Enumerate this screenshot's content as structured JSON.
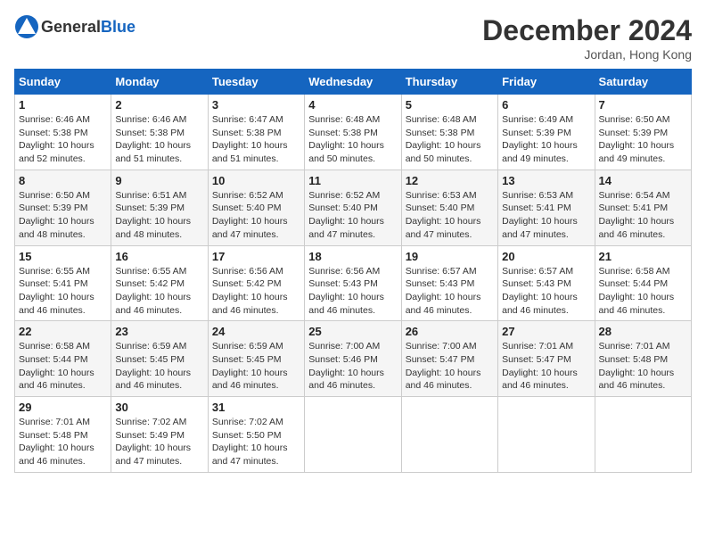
{
  "header": {
    "logo_general": "General",
    "logo_blue": "Blue",
    "month_title": "December 2024",
    "location": "Jordan, Hong Kong"
  },
  "columns": [
    "Sunday",
    "Monday",
    "Tuesday",
    "Wednesday",
    "Thursday",
    "Friday",
    "Saturday"
  ],
  "weeks": [
    [
      {
        "day": "1",
        "sunrise": "Sunrise: 6:46 AM",
        "sunset": "Sunset: 5:38 PM",
        "daylight": "Daylight: 10 hours and 52 minutes."
      },
      {
        "day": "2",
        "sunrise": "Sunrise: 6:46 AM",
        "sunset": "Sunset: 5:38 PM",
        "daylight": "Daylight: 10 hours and 51 minutes."
      },
      {
        "day": "3",
        "sunrise": "Sunrise: 6:47 AM",
        "sunset": "Sunset: 5:38 PM",
        "daylight": "Daylight: 10 hours and 51 minutes."
      },
      {
        "day": "4",
        "sunrise": "Sunrise: 6:48 AM",
        "sunset": "Sunset: 5:38 PM",
        "daylight": "Daylight: 10 hours and 50 minutes."
      },
      {
        "day": "5",
        "sunrise": "Sunrise: 6:48 AM",
        "sunset": "Sunset: 5:38 PM",
        "daylight": "Daylight: 10 hours and 50 minutes."
      },
      {
        "day": "6",
        "sunrise": "Sunrise: 6:49 AM",
        "sunset": "Sunset: 5:39 PM",
        "daylight": "Daylight: 10 hours and 49 minutes."
      },
      {
        "day": "7",
        "sunrise": "Sunrise: 6:50 AM",
        "sunset": "Sunset: 5:39 PM",
        "daylight": "Daylight: 10 hours and 49 minutes."
      }
    ],
    [
      {
        "day": "8",
        "sunrise": "Sunrise: 6:50 AM",
        "sunset": "Sunset: 5:39 PM",
        "daylight": "Daylight: 10 hours and 48 minutes."
      },
      {
        "day": "9",
        "sunrise": "Sunrise: 6:51 AM",
        "sunset": "Sunset: 5:39 PM",
        "daylight": "Daylight: 10 hours and 48 minutes."
      },
      {
        "day": "10",
        "sunrise": "Sunrise: 6:52 AM",
        "sunset": "Sunset: 5:40 PM",
        "daylight": "Daylight: 10 hours and 47 minutes."
      },
      {
        "day": "11",
        "sunrise": "Sunrise: 6:52 AM",
        "sunset": "Sunset: 5:40 PM",
        "daylight": "Daylight: 10 hours and 47 minutes."
      },
      {
        "day": "12",
        "sunrise": "Sunrise: 6:53 AM",
        "sunset": "Sunset: 5:40 PM",
        "daylight": "Daylight: 10 hours and 47 minutes."
      },
      {
        "day": "13",
        "sunrise": "Sunrise: 6:53 AM",
        "sunset": "Sunset: 5:41 PM",
        "daylight": "Daylight: 10 hours and 47 minutes."
      },
      {
        "day": "14",
        "sunrise": "Sunrise: 6:54 AM",
        "sunset": "Sunset: 5:41 PM",
        "daylight": "Daylight: 10 hours and 46 minutes."
      }
    ],
    [
      {
        "day": "15",
        "sunrise": "Sunrise: 6:55 AM",
        "sunset": "Sunset: 5:41 PM",
        "daylight": "Daylight: 10 hours and 46 minutes."
      },
      {
        "day": "16",
        "sunrise": "Sunrise: 6:55 AM",
        "sunset": "Sunset: 5:42 PM",
        "daylight": "Daylight: 10 hours and 46 minutes."
      },
      {
        "day": "17",
        "sunrise": "Sunrise: 6:56 AM",
        "sunset": "Sunset: 5:42 PM",
        "daylight": "Daylight: 10 hours and 46 minutes."
      },
      {
        "day": "18",
        "sunrise": "Sunrise: 6:56 AM",
        "sunset": "Sunset: 5:43 PM",
        "daylight": "Daylight: 10 hours and 46 minutes."
      },
      {
        "day": "19",
        "sunrise": "Sunrise: 6:57 AM",
        "sunset": "Sunset: 5:43 PM",
        "daylight": "Daylight: 10 hours and 46 minutes."
      },
      {
        "day": "20",
        "sunrise": "Sunrise: 6:57 AM",
        "sunset": "Sunset: 5:43 PM",
        "daylight": "Daylight: 10 hours and 46 minutes."
      },
      {
        "day": "21",
        "sunrise": "Sunrise: 6:58 AM",
        "sunset": "Sunset: 5:44 PM",
        "daylight": "Daylight: 10 hours and 46 minutes."
      }
    ],
    [
      {
        "day": "22",
        "sunrise": "Sunrise: 6:58 AM",
        "sunset": "Sunset: 5:44 PM",
        "daylight": "Daylight: 10 hours and 46 minutes."
      },
      {
        "day": "23",
        "sunrise": "Sunrise: 6:59 AM",
        "sunset": "Sunset: 5:45 PM",
        "daylight": "Daylight: 10 hours and 46 minutes."
      },
      {
        "day": "24",
        "sunrise": "Sunrise: 6:59 AM",
        "sunset": "Sunset: 5:45 PM",
        "daylight": "Daylight: 10 hours and 46 minutes."
      },
      {
        "day": "25",
        "sunrise": "Sunrise: 7:00 AM",
        "sunset": "Sunset: 5:46 PM",
        "daylight": "Daylight: 10 hours and 46 minutes."
      },
      {
        "day": "26",
        "sunrise": "Sunrise: 7:00 AM",
        "sunset": "Sunset: 5:47 PM",
        "daylight": "Daylight: 10 hours and 46 minutes."
      },
      {
        "day": "27",
        "sunrise": "Sunrise: 7:01 AM",
        "sunset": "Sunset: 5:47 PM",
        "daylight": "Daylight: 10 hours and 46 minutes."
      },
      {
        "day": "28",
        "sunrise": "Sunrise: 7:01 AM",
        "sunset": "Sunset: 5:48 PM",
        "daylight": "Daylight: 10 hours and 46 minutes."
      }
    ],
    [
      {
        "day": "29",
        "sunrise": "Sunrise: 7:01 AM",
        "sunset": "Sunset: 5:48 PM",
        "daylight": "Daylight: 10 hours and 46 minutes."
      },
      {
        "day": "30",
        "sunrise": "Sunrise: 7:02 AM",
        "sunset": "Sunset: 5:49 PM",
        "daylight": "Daylight: 10 hours and 47 minutes."
      },
      {
        "day": "31",
        "sunrise": "Sunrise: 7:02 AM",
        "sunset": "Sunset: 5:50 PM",
        "daylight": "Daylight: 10 hours and 47 minutes."
      },
      null,
      null,
      null,
      null
    ]
  ]
}
